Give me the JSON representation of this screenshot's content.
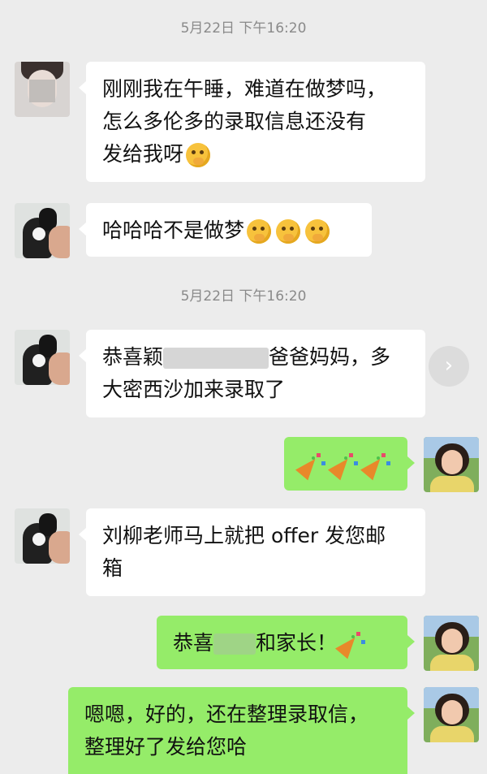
{
  "timestamps": [
    "5月22日 下午16:20",
    "5月22日 下午16:20"
  ],
  "messages": {
    "m1": {
      "line1": "刚刚我在午睡，难道在做梦吗，",
      "line2": "怎么多伦多的录取信息还没有",
      "line3": "发给我呀",
      "emoji": "thinking-emoji"
    },
    "m2": {
      "text": "哈哈哈不是做梦",
      "emoji": "thinking-emoji"
    },
    "m3": {
      "pre": "恭喜颖",
      "post": "爸爸妈妈，多",
      "line2": "大密西沙加来录取了"
    },
    "m4": {
      "emoji": "party-popper-emoji"
    },
    "m5": {
      "line1": "刘柳老师马上就把 offer 发您邮",
      "line2": "箱"
    },
    "m6": {
      "pre": "恭喜",
      "post": "和家长！",
      "emoji": "party-popper-emoji"
    },
    "m7": {
      "line1": "嗯嗯，好的，还在整理录取信，",
      "line2": "整理好了发给您哈"
    }
  },
  "icons": {
    "forward": "chevron-right-icon"
  },
  "colors": {
    "background": "#ececec",
    "incoming": "#ffffff",
    "outgoing": "#95ec69",
    "timestamp": "#8a8a8a"
  }
}
